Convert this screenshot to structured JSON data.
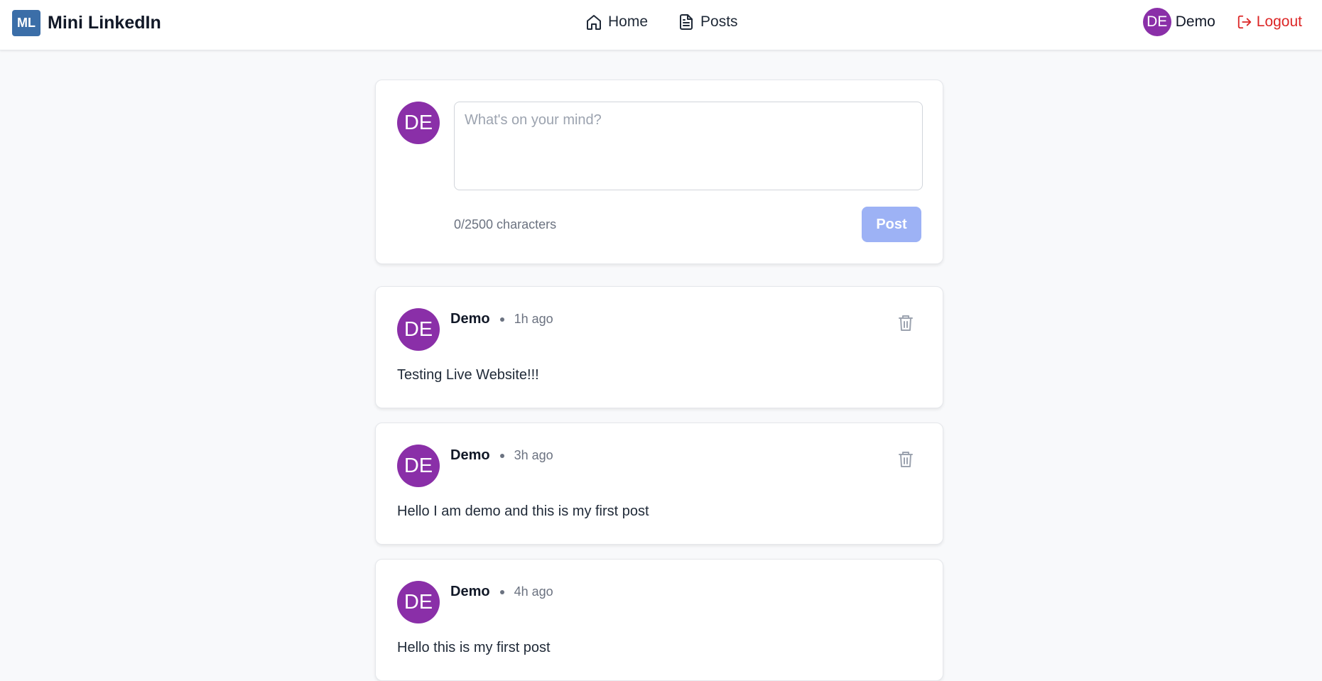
{
  "header": {
    "logo_text": "ML",
    "app_name": "Mini LinkedIn",
    "nav": [
      {
        "label": "Home",
        "icon": "home-icon"
      },
      {
        "label": "Posts",
        "icon": "document-icon"
      }
    ],
    "user": {
      "initials": "DE",
      "name": "Demo"
    },
    "logout_label": "Logout"
  },
  "composer": {
    "avatar_initials": "DE",
    "placeholder": "What's on your mind?",
    "value": "",
    "char_count": "0/2500 characters",
    "post_label": "Post"
  },
  "posts": [
    {
      "initials": "DE",
      "author": "Demo",
      "time": "1h ago",
      "text": "Testing Live Website!!!"
    },
    {
      "initials": "DE",
      "author": "Demo",
      "time": "3h ago",
      "text": "Hello I am demo and this is my first post"
    },
    {
      "initials": "DE",
      "author": "Demo",
      "time": "4h ago",
      "text": "Hello this is my first post"
    }
  ],
  "colors": {
    "brand": "#3b6ea8",
    "avatar": "#8a2fa8",
    "logout": "#dc2626",
    "post_button_disabled": "#9db2f5"
  }
}
